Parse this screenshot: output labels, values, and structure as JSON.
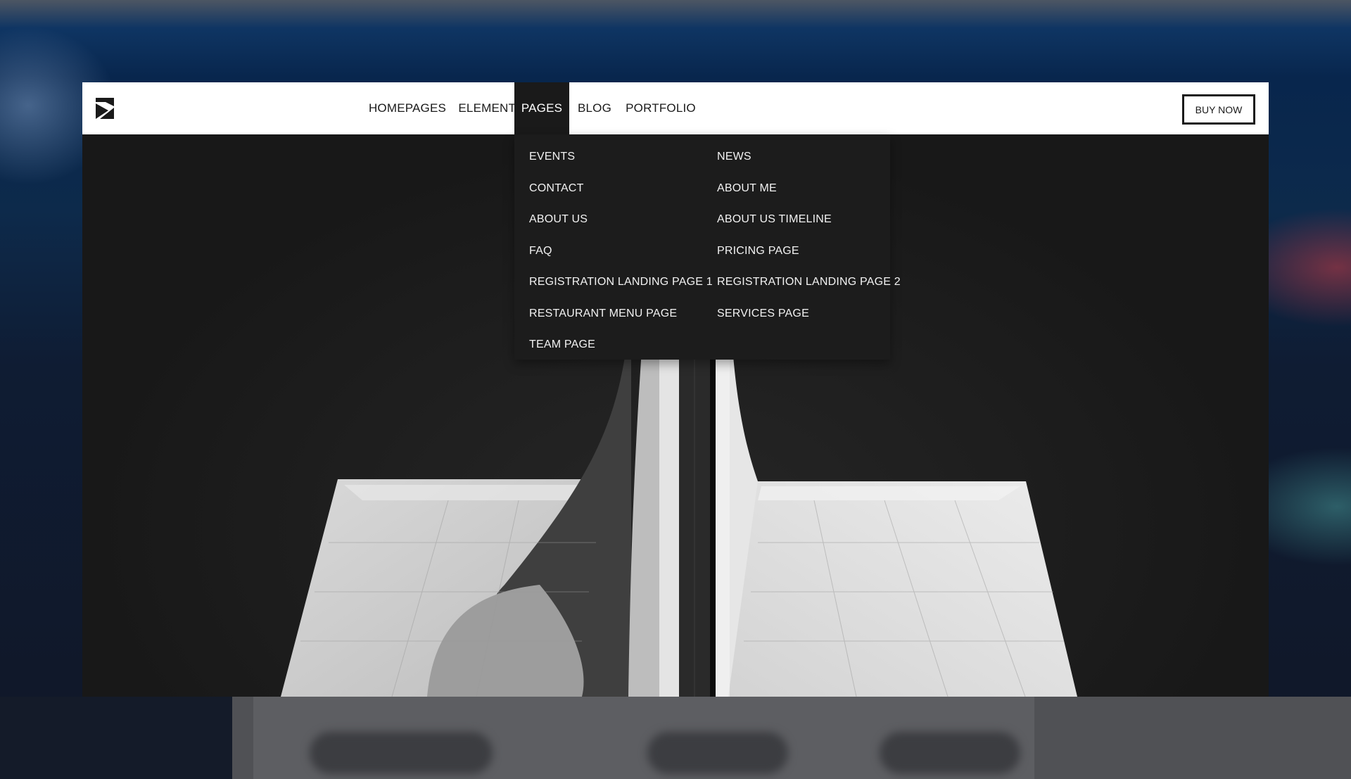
{
  "header": {
    "nav": [
      {
        "label": "HOMEPAGES",
        "active": false
      },
      {
        "label": "ELEMENTS",
        "active": false
      },
      {
        "label": "PAGES",
        "active": true
      },
      {
        "label": "BLOG",
        "active": false
      },
      {
        "label": "PORTFOLIO",
        "active": false
      }
    ],
    "buy_label": "BUY NOW",
    "logo_icon": "s-monogram-logo-icon"
  },
  "dropdown": {
    "left_column": [
      "EVENTS",
      "CONTACT",
      "ABOUT US",
      "FAQ",
      "REGISTRATION LANDING PAGE 1",
      "RESTAURANT MENU PAGE",
      "TEAM PAGE"
    ],
    "right_column": [
      "NEWS",
      "ABOUT ME",
      "ABOUT US TIMELINE",
      "PRICING PAGE",
      "REGISTRATION LANDING PAGE 2",
      "SERVICES PAGE"
    ]
  },
  "colors": {
    "header_bg": "#ffffff",
    "dark": "#1a1a1a",
    "dropdown_bg": "#1c1c1c",
    "text_light": "#f2f2f2"
  }
}
